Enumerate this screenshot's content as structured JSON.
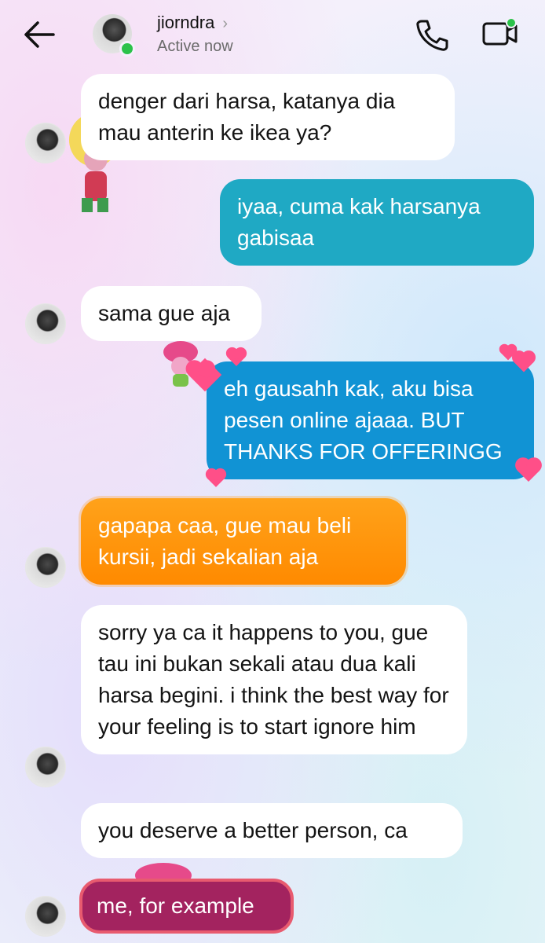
{
  "header": {
    "contact_name": "jiorndra",
    "chevron": "›",
    "status": "Active now",
    "icons": {
      "back": "back-arrow-icon",
      "call": "phone-icon",
      "video": "video-camera-icon"
    },
    "online_color": "#2bc24a"
  },
  "messages": [
    {
      "sender": "jiorndra",
      "direction": "incoming",
      "text": "denger dari harsa, katanya dia mau anterin ke ikea ya?"
    },
    {
      "sender": "me",
      "direction": "outgoing",
      "text": "iyaa, cuma kak harsanya gabisaa"
    },
    {
      "sender": "jiorndra",
      "direction": "incoming",
      "text": "sama gue aja"
    },
    {
      "sender": "me",
      "direction": "outgoing",
      "text": "eh gausahh kak, aku bisa pesen online ajaaa. BUT THANKS FOR OFFERINGG",
      "effect": "hearts"
    },
    {
      "sender": "jiorndra",
      "direction": "incoming",
      "text": "gapapa caa, gue mau beli kursii, jadi sekalian aja",
      "effect": "fire"
    },
    {
      "sender": "jiorndra",
      "direction": "incoming",
      "text": "sorry ya ca it happens to you, gue tau ini bukan sekali atau dua kali harsa begini. i think the best way for your feeling is to start ignore him"
    },
    {
      "sender": "jiorndra",
      "direction": "incoming",
      "text": "you deserve a better person, ca"
    },
    {
      "sender": "jiorndra",
      "direction": "incoming",
      "text": "me, for example",
      "effect": "highlight"
    }
  ],
  "colors": {
    "outgoing_teal": "#1fa9c4",
    "outgoing_blue": "#1193d4",
    "fire": "#ff8a00",
    "highlight": "#a3235f",
    "heart": "#ff4f88"
  }
}
